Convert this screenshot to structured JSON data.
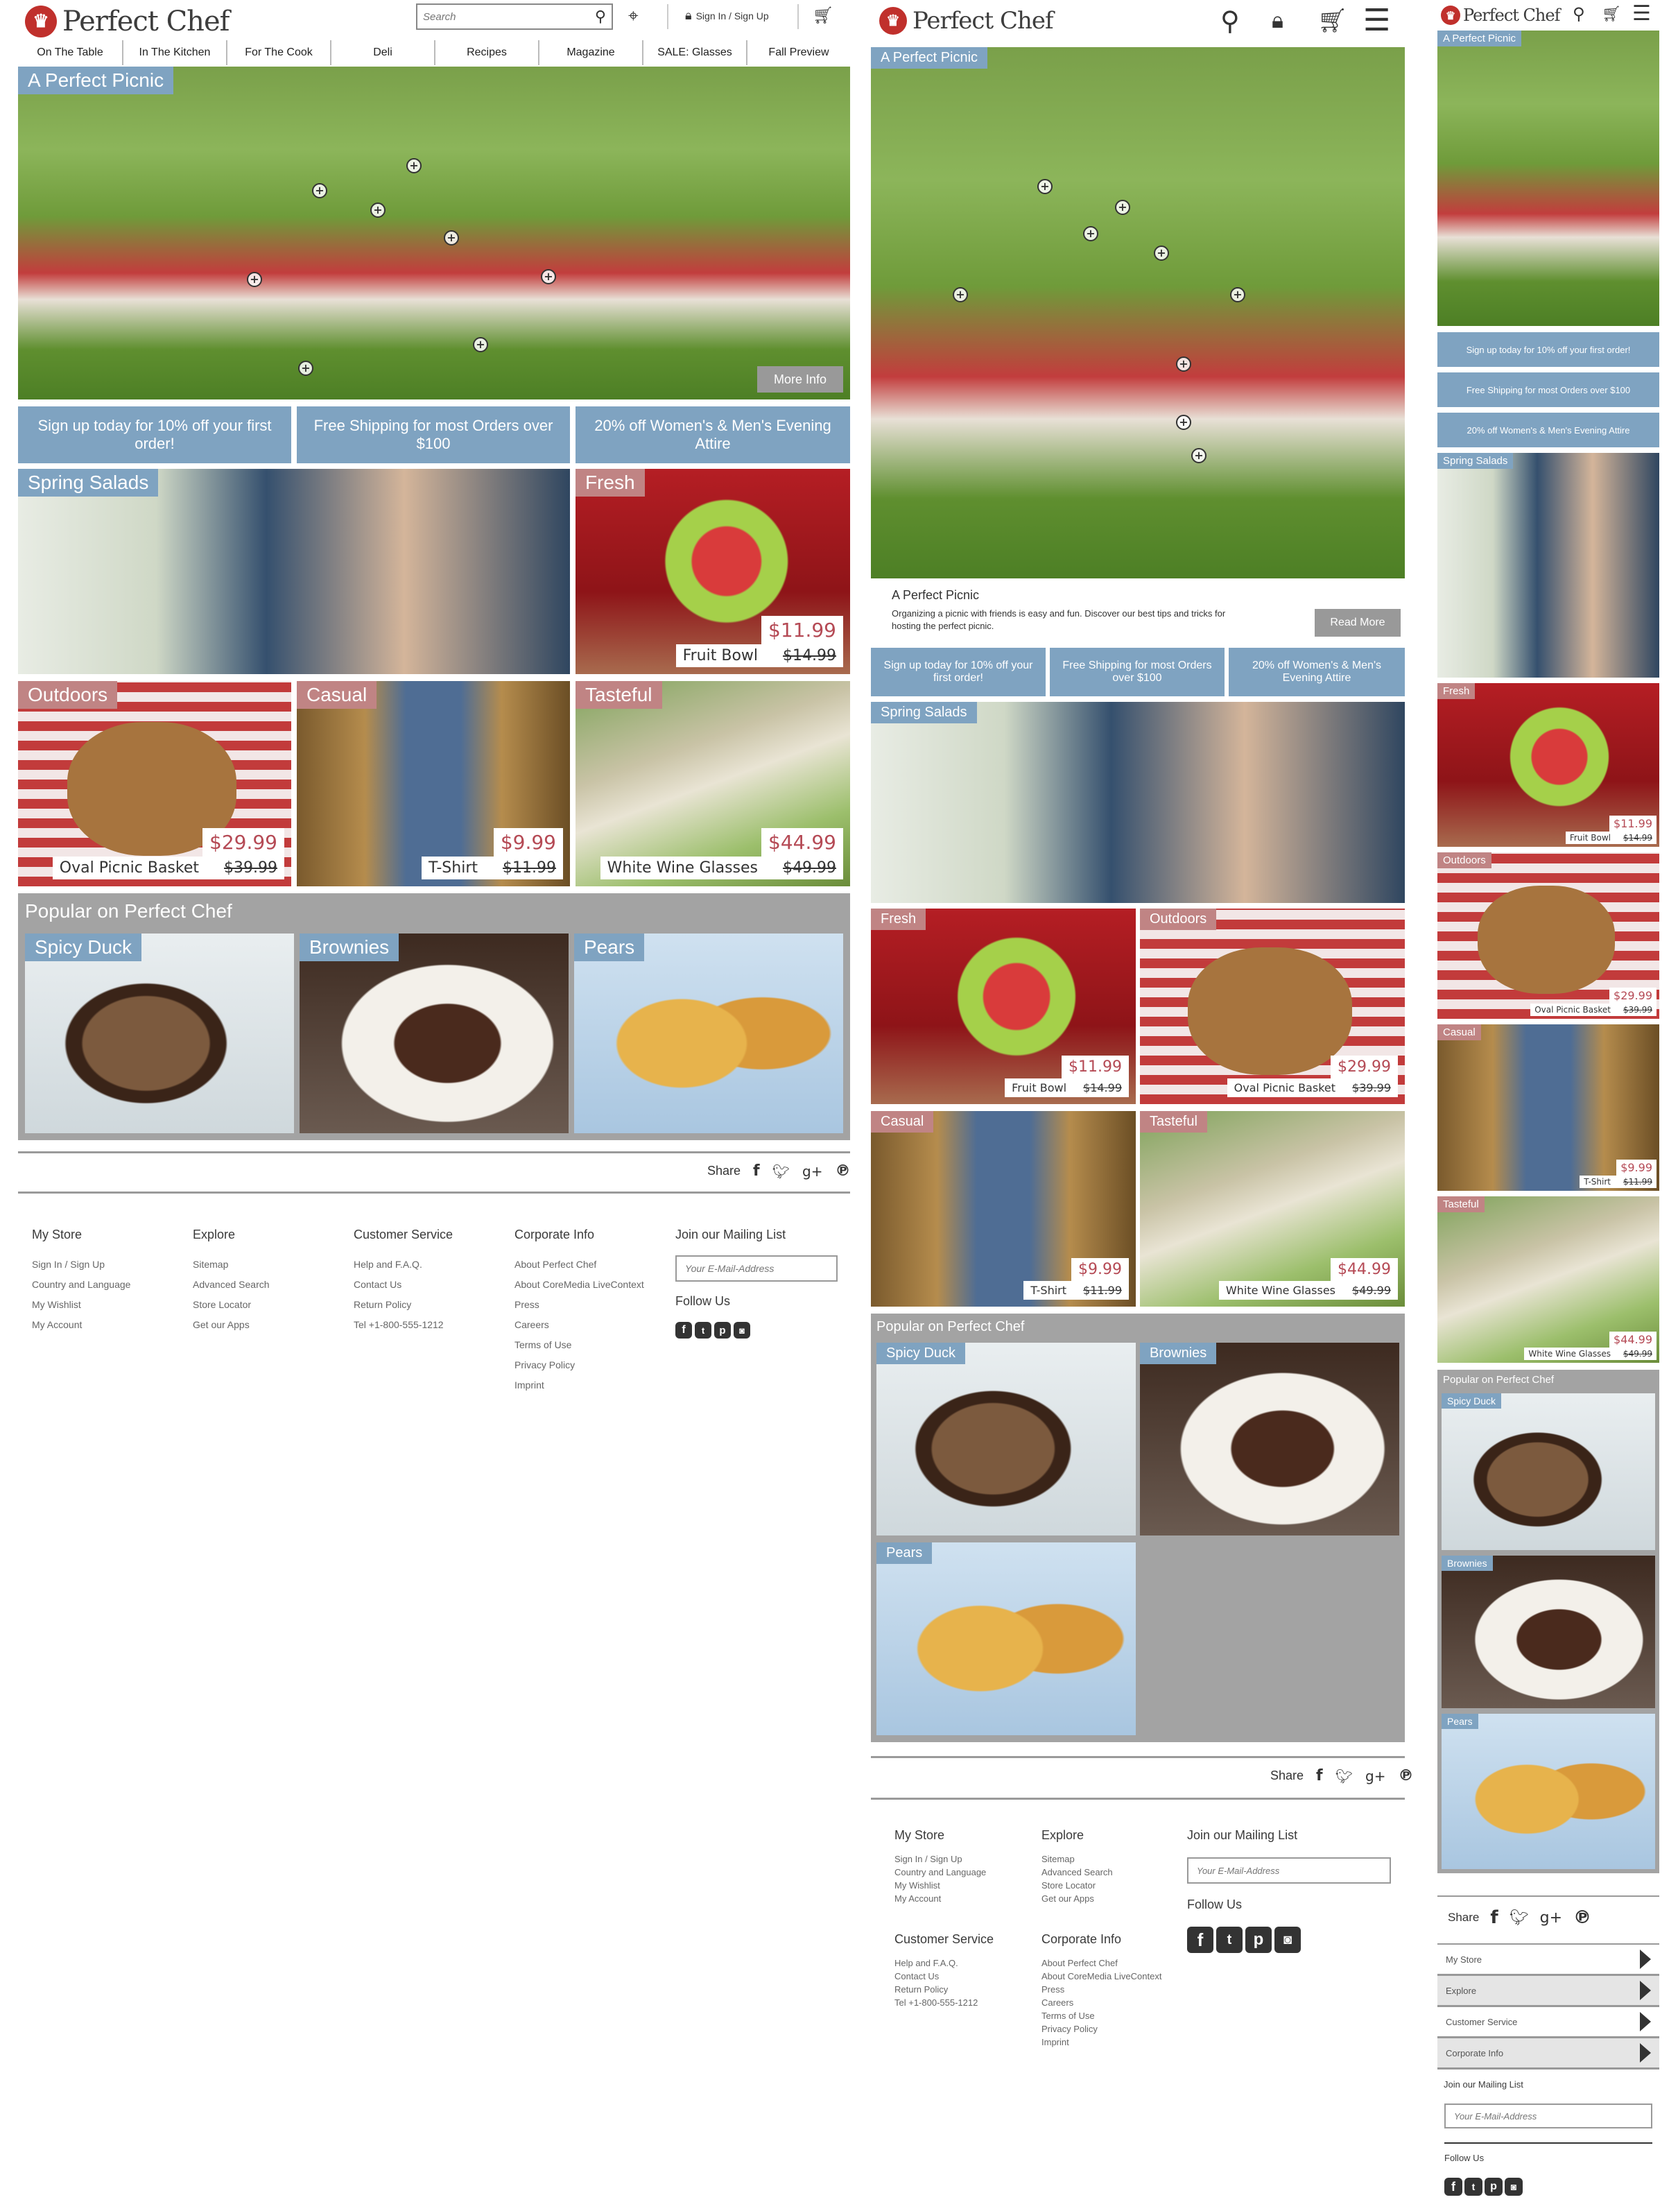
{
  "brand": {
    "name": "Perfect Chef",
    "logo_glyph": "chef-hat-logo"
  },
  "desktop": {
    "search_placeholder": "Search",
    "signin_label": "Sign In / Sign Up",
    "nav": [
      "On The Table",
      "In The Kitchen",
      "For The Cook",
      "Deli",
      "Recipes",
      "Magazine",
      "SALE: Glasses",
      "Fall Preview"
    ],
    "hero": {
      "tag": "A Perfect Picnic",
      "button": "More Info"
    },
    "promos": [
      "Sign up today for 10% off your first order!",
      "Free Shipping for most Orders over $100",
      "20% off Women's & Men's Evening Attire"
    ]
  },
  "tablet": {
    "hero": {
      "tag": "A Perfect Picnic",
      "title": "A Perfect Picnic",
      "text": "Organizing a picnic with friends is easy and fun. Discover our best tips and tricks for hosting the perfect picnic.",
      "button": "Read More"
    }
  },
  "teasers": {
    "spring_salads": "Spring Salads",
    "fresh": "Fresh",
    "outdoors": "Outdoors",
    "casual": "Casual",
    "tasteful": "Tasteful"
  },
  "products": {
    "fruit_bowl": {
      "name": "Fruit Bowl",
      "price": "$11.99",
      "old_price": "$14.99"
    },
    "picnic_basket": {
      "name": "Oval Picnic Basket",
      "price": "$29.99",
      "old_price": "$39.99"
    },
    "tshirt": {
      "name": "T-Shirt",
      "price": "$9.99",
      "old_price": "$11.99"
    },
    "wine_glasses": {
      "name": "White Wine Glasses",
      "price": "$44.99",
      "old_price": "$49.99"
    }
  },
  "popular": {
    "title": "Popular on Perfect Chef",
    "items": [
      "Spicy Duck",
      "Brownies",
      "Pears"
    ]
  },
  "share": {
    "label": "Share",
    "icons": [
      "facebook-icon",
      "twitter-icon",
      "google-plus-icon",
      "pinterest-icon"
    ]
  },
  "footer": {
    "my_store": {
      "title": "My Store",
      "links": [
        "Sign In / Sign Up",
        "Country and Language",
        "My Wishlist",
        "My Account"
      ]
    },
    "explore": {
      "title": "Explore",
      "links": [
        "Sitemap",
        "Advanced Search",
        "Store Locator",
        "Get our Apps"
      ]
    },
    "customer_service": {
      "title": "Customer Service",
      "links": [
        "Help and F.A.Q.",
        "Contact Us",
        "Return Policy",
        "Tel +1-800-555-1212"
      ]
    },
    "corporate_info": {
      "title": "Corporate Info",
      "links": [
        "About Perfect Chef",
        "About CoreMedia LiveContext",
        "Press",
        "Careers",
        "Terms of Use",
        "Privacy Policy",
        "Imprint"
      ]
    },
    "mailing": {
      "title": "Join our Mailing List",
      "placeholder": "Your E-Mail-Address"
    },
    "follow": {
      "title": "Follow Us",
      "icons": [
        "facebook-icon",
        "twitter-icon",
        "pinterest-icon",
        "instagram-icon"
      ]
    }
  },
  "colors": {
    "accent_blue": "#7fa3c1",
    "accent_rose": "#c08484",
    "price_red": "#b54a55",
    "logo_red": "#c0302c",
    "popular_bg": "#a3a3a3"
  }
}
